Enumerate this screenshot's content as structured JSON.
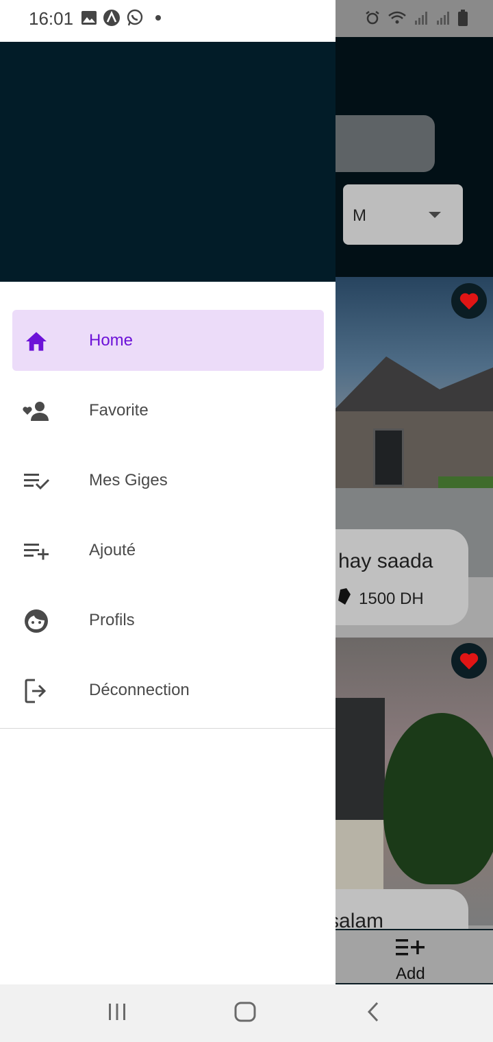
{
  "status_bar": {
    "time": "16:01",
    "notification_icons": [
      "image-icon",
      "app-icon",
      "whatsapp-icon",
      "dot-icon"
    ],
    "system_icons": [
      "alarm-icon",
      "wifi-icon",
      "signal-icon",
      "signal-icon",
      "battery-icon"
    ]
  },
  "background_app": {
    "dropdown_value": "M",
    "cards": [
      {
        "title": "hay saada",
        "price": "1500 DH"
      },
      {
        "title": "ay salam"
      }
    ],
    "bottom_nav": {
      "add_label": "Add"
    }
  },
  "drawer": {
    "menu": [
      {
        "label": "Home",
        "icon": "home-icon",
        "active": true
      },
      {
        "label": "Favorite",
        "icon": "person-heart-icon",
        "active": false
      },
      {
        "label": "Mes Giges",
        "icon": "playlist-check-icon",
        "active": false
      },
      {
        "label": "Ajouté",
        "icon": "playlist-add-icon",
        "active": false
      },
      {
        "label": "Profils",
        "icon": "face-icon",
        "active": false
      },
      {
        "label": "Déconnection",
        "icon": "logout-icon",
        "active": false
      }
    ]
  },
  "colors": {
    "header": "#021c28",
    "active_bg": "#ecdcf9",
    "active_text": "#6c12d8",
    "icon_gray": "#4a4a4a",
    "heart_red": "#e01515"
  },
  "system_nav": [
    "recent-apps-button",
    "home-button",
    "back-button"
  ]
}
